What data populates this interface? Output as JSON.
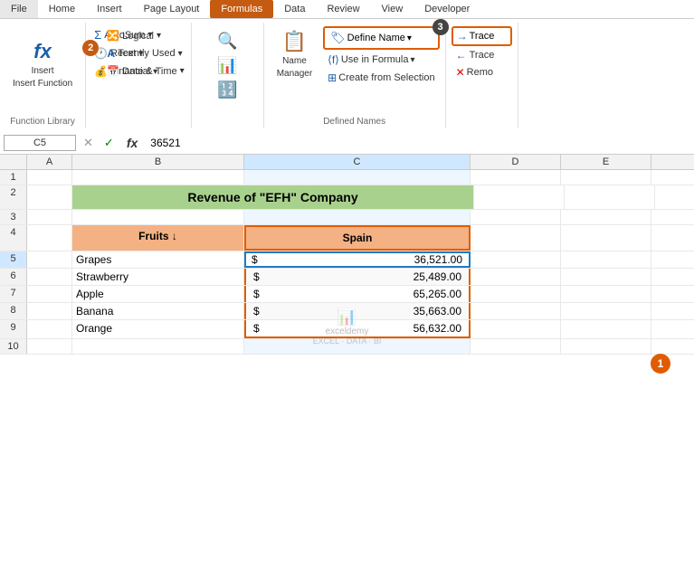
{
  "tabs": {
    "items": [
      "File",
      "Home",
      "Insert",
      "Page Layout",
      "Formulas",
      "Data",
      "Review",
      "View",
      "Developer"
    ],
    "active": "Formulas"
  },
  "ribbon": {
    "groups": {
      "function_library": {
        "label": "Function Library",
        "buttons": {
          "insert_function": "Insert\nFunction",
          "autosum": "AutoSum",
          "recently_used": "Recently Used",
          "financial": "Financial",
          "logical": "Logical",
          "text": "Text",
          "date_time": "Date & Time"
        }
      },
      "defined_names": {
        "label": "Defined Names",
        "define_name": "Define Name",
        "use_in_formula": "Use in Formula",
        "create_from_selection": "Create from Selection",
        "name_manager": "Name\nManager"
      },
      "trace": {
        "trace_precedents": "Trace",
        "trace_dependents": "Trace",
        "remove_arrows": "Remo"
      }
    }
  },
  "formula_bar": {
    "cell_ref": "C5",
    "value": "36521"
  },
  "spreadsheet": {
    "columns": {
      "widths": [
        30,
        50,
        190,
        250,
        100,
        100
      ],
      "labels": [
        "",
        "A",
        "B",
        "C",
        "D",
        "E"
      ]
    },
    "title": "Revenue of \"EFH\" Company",
    "headers": {
      "fruit": "Fruits ↓",
      "spain": "Spain"
    },
    "rows": [
      {
        "row": 5,
        "fruit": "Grapes",
        "dollar": "$",
        "value": "36,521.00"
      },
      {
        "row": 6,
        "fruit": "Strawberry",
        "dollar": "$",
        "value": "25,489.00"
      },
      {
        "row": 7,
        "fruit": "Apple",
        "dollar": "$",
        "value": "65,265.00"
      },
      {
        "row": 8,
        "fruit": "Banana",
        "dollar": "$",
        "value": "35,663.00"
      },
      {
        "row": 9,
        "fruit": "Orange",
        "dollar": "$",
        "value": "56,632.00"
      }
    ]
  },
  "annotations": {
    "badge2_label": "2",
    "badge3_label": "3",
    "badge1_label": "1"
  },
  "icons": {
    "fx": "fx",
    "checkmark": "✓",
    "cross": "✕",
    "dropdown_arrow": "▾",
    "name_manager_icon": "📋",
    "define_icon": "🏷",
    "use_formula_icon": "⟨⟩",
    "create_sel_icon": "⊞",
    "trace_icon": "→",
    "autosum_icon": "Σ",
    "recently_used_icon": "🕐",
    "financial_icon": "$",
    "logical_icon": "⊤",
    "text_icon": "A",
    "datetime_icon": "📅"
  },
  "watermark": "exceldemy\nEXCEL · DATA · BI"
}
